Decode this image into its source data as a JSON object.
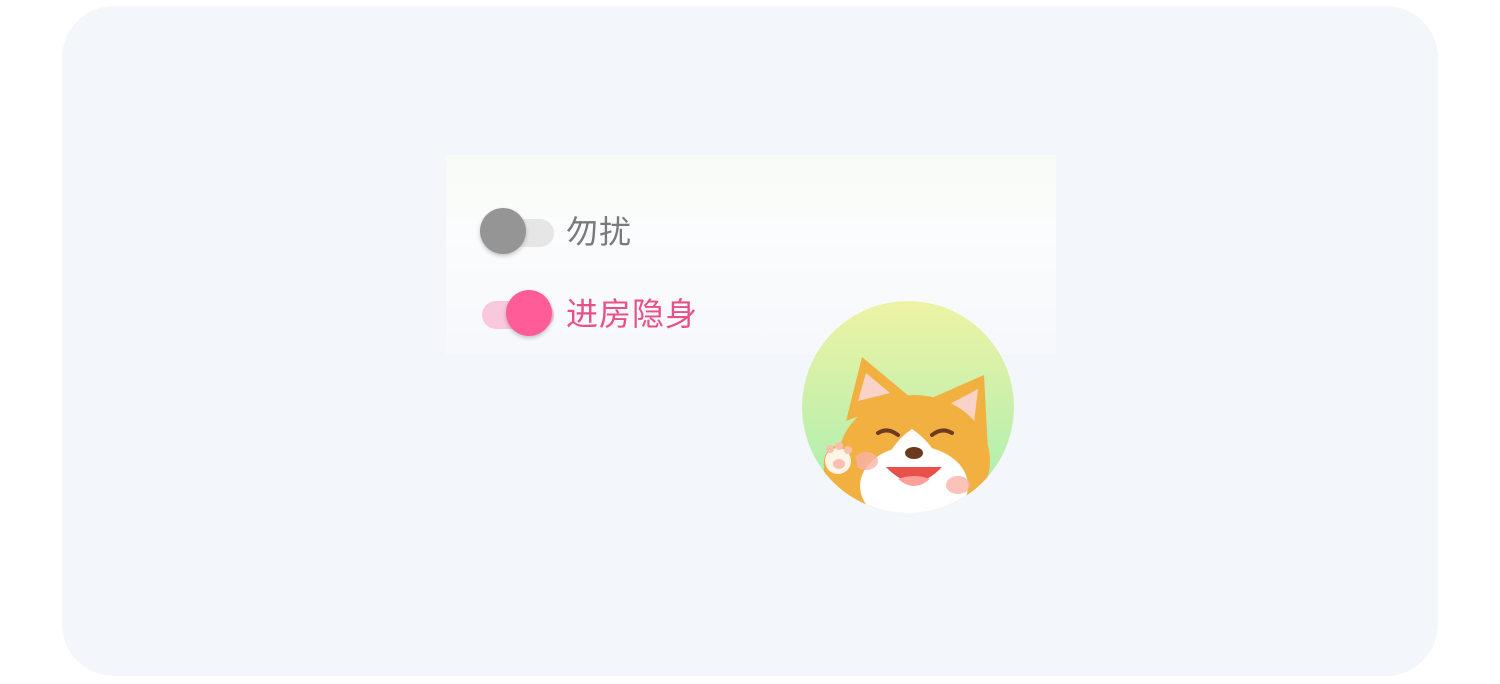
{
  "colors": {
    "card_bg": "#f3f6fa",
    "off_knob": "#959595",
    "off_track": "#e6e6e6",
    "off_label": "#7a7a7a",
    "on_knob": "#ff5c98",
    "on_track": "#f9c8dc",
    "on_label": "#e8508a",
    "avatar_gradient_top": "#eef3a4",
    "avatar_gradient_bottom": "#a6eeb2"
  },
  "toggles": [
    {
      "label": "勿扰",
      "state": "off",
      "knob_icon": "toggle-off"
    },
    {
      "label": "进房隐身",
      "state": "on",
      "knob_icon": "toggle-on"
    }
  ],
  "avatar": {
    "icon": "corgi-waving-icon"
  }
}
